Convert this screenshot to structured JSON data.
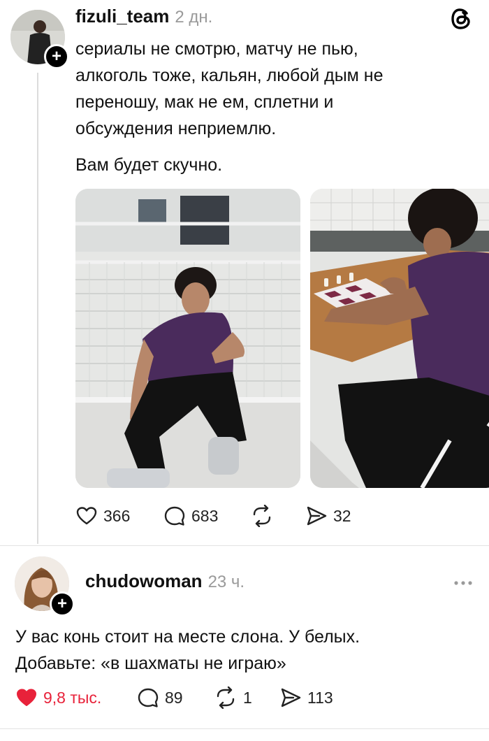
{
  "post1": {
    "username": "fizuli_team",
    "time": "2 дн.",
    "text": "сериалы не смотрю, матчу не пью,\nалкоголь тоже, кальян, любой дым не\nпереношу, мак не ем, сплетни и\nобсуждения неприемлю.",
    "text2": "Вам будет скучно.",
    "stats": {
      "likes": "366",
      "comments": "683",
      "shares": "32"
    }
  },
  "post2": {
    "username": "chudowoman",
    "time": "23 ч.",
    "text": "У вас конь стоит на месте слона. У белых.\nДобавьте: «в шахматы не играю»",
    "stats": {
      "likes": "9,8 тыс.",
      "comments": "89",
      "reposts": "1",
      "shares": "113"
    }
  },
  "icons": {
    "app": "threads-logo-icon",
    "like": "heart-icon",
    "comment": "comment-bubble-icon",
    "repost": "repost-icon",
    "share": "send-icon",
    "menu": "more-dots-icon"
  },
  "colors": {
    "liked": "#e8223a",
    "shirt": "#4a2b5c"
  }
}
